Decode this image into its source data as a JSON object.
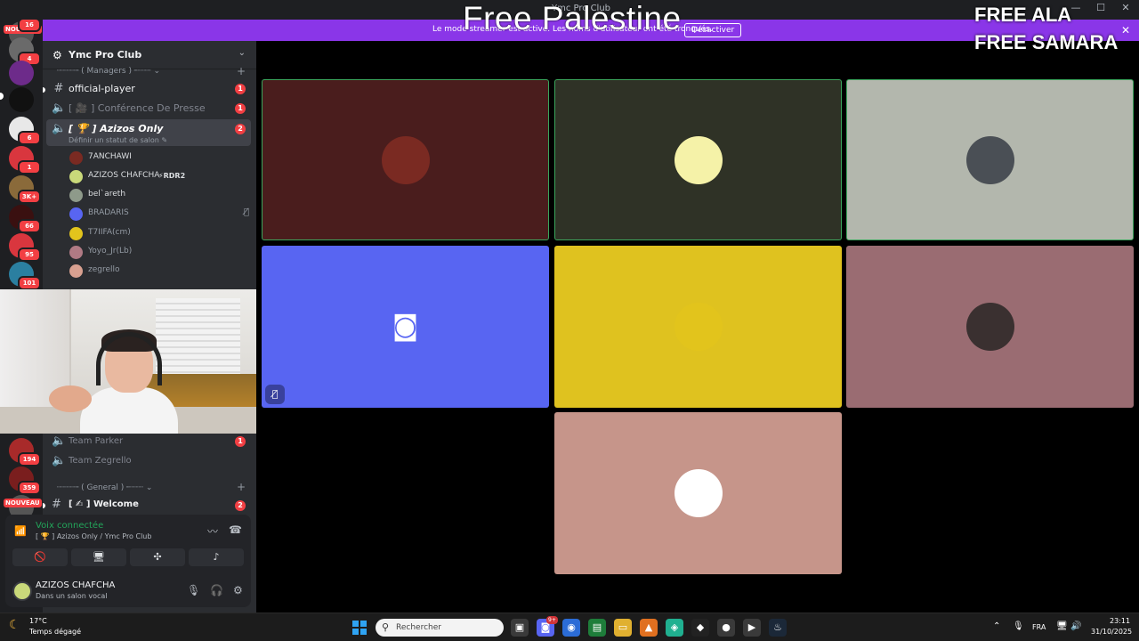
{
  "window": {
    "title": "Ymc Pro Club"
  },
  "overlay": {
    "top_text": "Free Palestine",
    "right_line1": "FREE ALA",
    "right_line2": "FREE SAMARA"
  },
  "banner": {
    "text": "Le mode streamer est activé. Les noms d'utilisateur ont été tronqués.",
    "button": "Désactiver"
  },
  "rail": {
    "badges": [
      "16",
      "4",
      "6",
      "1",
      "3K+",
      "66",
      "95",
      "101",
      "194",
      "359"
    ],
    "nouveau": "NOUVEAU"
  },
  "server": {
    "name": "Ymc Pro Club"
  },
  "categories": {
    "managers": "Managers",
    "general": "General"
  },
  "channels": [
    {
      "name": "official-player",
      "badge": "1"
    },
    {
      "name": "Conférence De Presse",
      "badge": "1",
      "prefix": "[ 🎥 ]"
    },
    {
      "name": "Azizos Only",
      "badge": "2",
      "prefix": "[ 🏆 ]",
      "subtitle": "Définir un statut de salon ✎"
    }
  ],
  "voice_users": [
    {
      "name": "7ANCHAWI",
      "color": "#7a2a22"
    },
    {
      "name": "AZIZOS CHAFCHA",
      "tag": "⚡RDR2",
      "color": "#c9d97a"
    },
    {
      "name": "bel`areth",
      "color": "#8e9a8a"
    },
    {
      "name": "BRADARIS",
      "color": "#5865f2",
      "muted": true
    },
    {
      "name": "T7IIFA(cm)",
      "color": "#e2c41c"
    },
    {
      "name": "Yoyo_Jr(Lb)",
      "color": "#b07a84"
    },
    {
      "name": "zegrello",
      "color": "#d8a090"
    }
  ],
  "lower_channels": [
    {
      "name": "Team Parker",
      "badge": "1"
    },
    {
      "name": "Team Zegrello"
    },
    {
      "name": "Welcome",
      "badge": "2",
      "prefix": "[ ✍ ]"
    }
  ],
  "voice_panel": {
    "status": "Voix connectée",
    "location": "[ 🏆 ] Azizos Only / Ymc Pro Club",
    "user_name": "AZIZOS CHAFCHA",
    "user_status": "Dans un salon vocal"
  },
  "tiles": [
    {
      "bg": "#4a1d1d",
      "avatar": "#7a2a22",
      "speaking": true
    },
    {
      "bg": "#2f3226",
      "avatar": "#f5f2a8",
      "speaking": true
    },
    {
      "bg": "#b3b7ad",
      "avatar": "#4a4f55",
      "speaking": true
    },
    {
      "bg": "#5865f2",
      "avatar": "discord",
      "muted": true
    },
    {
      "bg": "#dfc21f",
      "avatar": "#e2c41c"
    },
    {
      "bg": "#9a6c72",
      "avatar": "#3a3030"
    },
    {
      "bg": "#c6958a",
      "avatar": "#ffffff"
    }
  ],
  "taskbar": {
    "temp": "17°C",
    "condition": "Temps dégagé",
    "search": "Rechercher",
    "language": "FRA",
    "time": "23:11",
    "date": "31/10/2025",
    "app_badge": "9+"
  }
}
